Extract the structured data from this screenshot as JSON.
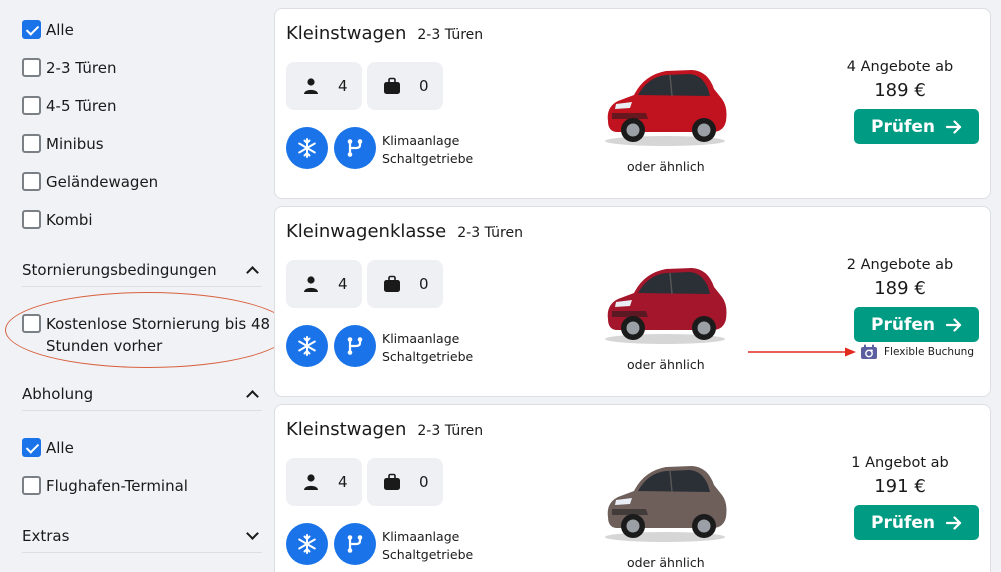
{
  "colors": {
    "accent": "#1a73e8",
    "cta": "#009b83",
    "annotation_ellipse": "#d7603f",
    "annotation_arrow": "#e02a20",
    "flex_icon": "#5b5fa0"
  },
  "sidebar": {
    "vehicle_types": [
      {
        "label": "Alle",
        "checked": true
      },
      {
        "label": "2-3 Türen",
        "checked": false
      },
      {
        "label": "4-5 Türen",
        "checked": false
      },
      {
        "label": "Minibus",
        "checked": false
      },
      {
        "label": "Geländewagen",
        "checked": false
      },
      {
        "label": "Kombi",
        "checked": false
      }
    ],
    "cancellation": {
      "heading": "Stornierungsbedingungen",
      "expanded": true,
      "option": {
        "label": "Kostenlose Stornierung bis 48 Stunden vorher",
        "checked": false
      }
    },
    "pickup": {
      "heading": "Abholung",
      "expanded": true,
      "options": [
        {
          "label": "Alle",
          "checked": true
        },
        {
          "label": "Flughafen-Terminal",
          "checked": false
        }
      ]
    },
    "extras": {
      "heading": "Extras",
      "expanded": false
    }
  },
  "cards": [
    {
      "name": "Kleinstwagen",
      "doors": "2-3 Türen",
      "passengers": "4",
      "bags": "0",
      "feature1": "Klimaanlage",
      "feature2": "Schaltgetriebe",
      "similar": "oder ähnlich",
      "offers": "4 Angebote ab",
      "price": "189 €",
      "button": "Prüfen",
      "car_color": "#c1121f",
      "flexible_booking": ""
    },
    {
      "name": "Kleinwagenklasse",
      "doors": "2-3 Türen",
      "passengers": "4",
      "bags": "0",
      "feature1": "Klimaanlage",
      "feature2": "Schaltgetriebe",
      "similar": "oder ähnlich",
      "offers": "2 Angebote ab",
      "price": "189 €",
      "button": "Prüfen",
      "car_color": "#a4162b",
      "flexible_booking": "Flexible Buchung"
    },
    {
      "name": "Kleinstwagen",
      "doors": "2-3 Türen",
      "passengers": "4",
      "bags": "0",
      "feature1": "Klimaanlage",
      "feature2": "Schaltgetriebe",
      "similar": "oder ähnlich",
      "offers": "1 Angebot ab",
      "price": "191 €",
      "button": "Prüfen",
      "car_color": "#6e5f5b",
      "flexible_booking": ""
    }
  ]
}
